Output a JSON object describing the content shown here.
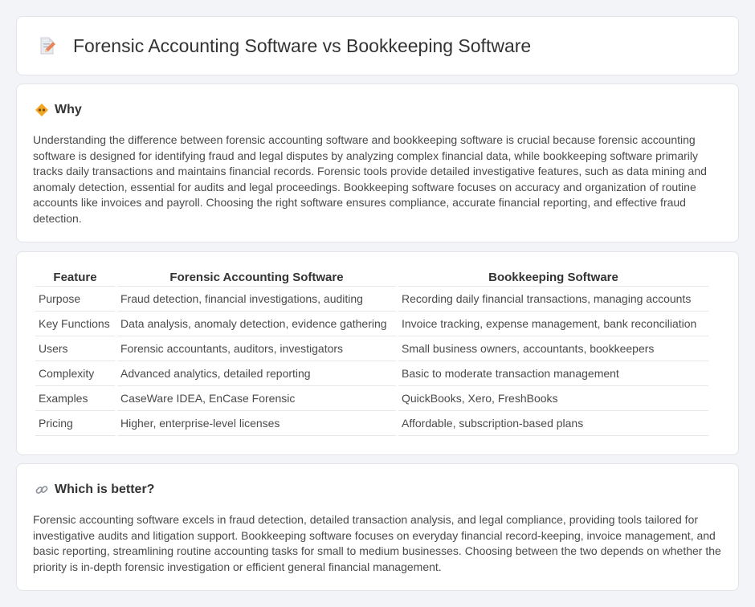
{
  "header": {
    "title": "Forensic Accounting Software vs Bookkeeping Software",
    "icon": "document-pencil-icon"
  },
  "why": {
    "title": "Why",
    "icon": "diamond-warning-icon",
    "text": "Understanding the difference between forensic accounting software and bookkeeping software is crucial because forensic accounting software is designed for identifying fraud and legal disputes by analyzing complex financial data, while bookkeeping software primarily tracks daily transactions and maintains financial records. Forensic tools provide detailed investigative features, such as data mining and anomaly detection, essential for audits and legal proceedings. Bookkeeping software focuses on accuracy and organization of routine accounts like invoices and payroll. Choosing the right software ensures compliance, accurate financial reporting, and effective fraud detection."
  },
  "table": {
    "headers": [
      "Feature",
      "Forensic Accounting Software",
      "Bookkeeping Software"
    ],
    "rows": [
      [
        "Purpose",
        "Fraud detection, financial investigations, auditing",
        "Recording daily financial transactions, managing accounts"
      ],
      [
        "Key Functions",
        "Data analysis, anomaly detection, evidence gathering",
        "Invoice tracking, expense management, bank reconciliation"
      ],
      [
        "Users",
        "Forensic accountants, auditors, investigators",
        "Small business owners, accountants, bookkeepers"
      ],
      [
        "Complexity",
        "Advanced analytics, detailed reporting",
        "Basic to moderate transaction management"
      ],
      [
        "Examples",
        "CaseWare IDEA, EnCase Forensic",
        "QuickBooks, Xero, FreshBooks"
      ],
      [
        "Pricing",
        "Higher, enterprise-level licenses",
        "Affordable, subscription-based plans"
      ]
    ]
  },
  "better": {
    "title": "Which is better?",
    "icon": "link-icon",
    "text": "Forensic accounting software excels in fraud detection, detailed transaction analysis, and legal compliance, providing tools tailored for investigative audits and litigation support. Bookkeeping software focuses on everyday financial record-keeping, invoice management, and basic reporting, streamlining routine accounting tasks for small to medium businesses. Choosing between the two depends on whether the priority is in-depth forensic investigation or efficient general financial management."
  },
  "colors": {
    "background": "#f3f4f7",
    "card": "#ffffff",
    "icon_accent": "#e8845a",
    "warning_accent": "#f2a623"
  }
}
